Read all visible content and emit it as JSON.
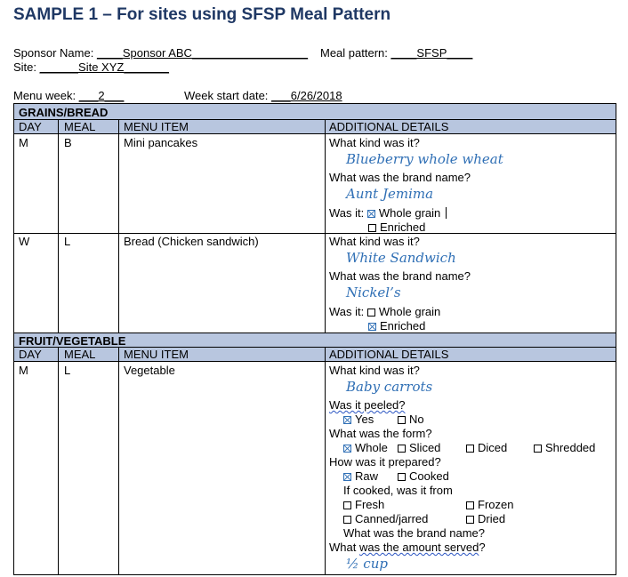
{
  "title": "SAMPLE 1 – For sites using SFSP Meal Pattern",
  "sponsor": {
    "label": "Sponsor Name:",
    "lead": "____",
    "value": "Sponsor ABC",
    "trail": "__________________"
  },
  "meal_pattern": {
    "label": "Meal pattern:",
    "lead": "____",
    "value": "SFSP",
    "trail": "____"
  },
  "site": {
    "label": "Site:",
    "lead": "______",
    "value": "Site XYZ",
    "trail": "_______"
  },
  "menu_week": {
    "label": "Menu week:",
    "lead": "___",
    "value": "2",
    "trail": "___"
  },
  "week_start": {
    "label": "Week start date:",
    "lead": "___",
    "value": "6/26/2018"
  },
  "columns": {
    "day": "DAY",
    "meal": "MEAL",
    "item": "MENU ITEM",
    "details": "ADDITIONAL DETAILS"
  },
  "sections": {
    "grains": "GRAINS/BREAD",
    "fruitveg": "FRUIT/VEGETABLE"
  },
  "questions": {
    "kind": "What kind was it?",
    "brand": "What was the brand name?",
    "was_it": "Was it:",
    "whole_grain": "Whole grain",
    "enriched": "Enriched",
    "peeled": "Was it peeled?",
    "yes": "Yes",
    "no": "No",
    "form": "What was the form?",
    "whole": "Whole",
    "sliced": "Sliced",
    "diced": "Diced",
    "shredded": "Shredded",
    "prepared": "How was it prepared?",
    "raw": "Raw",
    "cooked": "Cooked",
    "if_cooked": "If cooked, was it from",
    "fresh": "Fresh",
    "frozen": "Frozen",
    "canned": "Canned/jarred",
    "dried": "Dried",
    "amount": "What was the amount served?"
  },
  "rows": [
    {
      "day": "M",
      "meal": "B",
      "item": "Mini pancakes",
      "kind": "Blueberry whole wheat",
      "brand": "Aunt Jemima",
      "whole_grain_checked": true,
      "enriched_checked": false
    },
    {
      "day": "W",
      "meal": "L",
      "item": "Bread (Chicken sandwich)",
      "kind": "White Sandwich",
      "brand": "Nickel’s",
      "whole_grain_checked": false,
      "enriched_checked": true
    },
    {
      "day": "M",
      "meal": "L",
      "item": "Vegetable",
      "kind": "Baby carrots",
      "peeled_yes": true,
      "form_whole": true,
      "prep_raw": true,
      "amount": "½ cup"
    }
  ],
  "checkbox_color": "#2f6fb5",
  "band_color": "#b8c6df",
  "title_color": "#1f3864"
}
